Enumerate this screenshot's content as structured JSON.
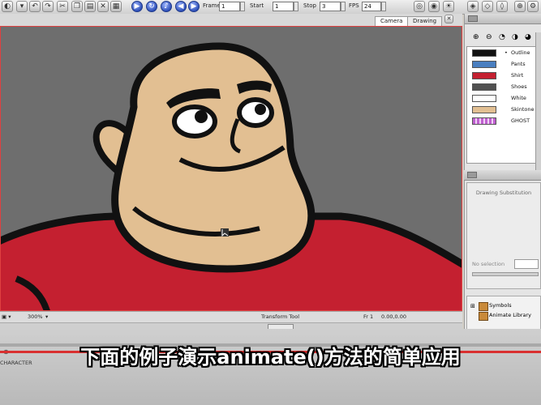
{
  "toolbar": {
    "frame_label": "Frame",
    "frame_value": "1",
    "start_label": "Start",
    "start_value": "1",
    "stop_label": "Stop",
    "stop_value": "3",
    "fps_label": "FPS",
    "fps_value": "24"
  },
  "viewport": {
    "tabs": [
      "Camera",
      "Drawing"
    ],
    "active_tab": "Camera"
  },
  "status_bar": {
    "zoom": "300%",
    "tool": "Transform Tool",
    "frame": "Fr 1",
    "coords": "0.00,0.00"
  },
  "palette": {
    "colors": [
      {
        "name": "Outline",
        "color": "#111111",
        "selected": true
      },
      {
        "name": "Pants",
        "color": "#4a7fc0",
        "selected": false
      },
      {
        "name": "Shirt",
        "color": "#c42030",
        "selected": false
      },
      {
        "name": "Shoes",
        "color": "#505050",
        "selected": false
      },
      {
        "name": "White",
        "color": "#ffffff",
        "selected": false
      },
      {
        "name": "Skintone",
        "color": "#e2bf92",
        "selected": false
      },
      {
        "name": "GHOST",
        "color": "#c060d0",
        "selected": false
      }
    ]
  },
  "drawing_panel": {
    "title": "Drawing Substitution",
    "no_selection": "No selection"
  },
  "library": {
    "items": [
      "Symbols",
      "Animate Library"
    ]
  },
  "timeline": {
    "label": "CHARACTER"
  },
  "subtitle": "下面的例子演示animate()方法的简单应用",
  "colors": {
    "canvas_bg": "#6e6e6e",
    "skin": "#e2bf92",
    "shirt": "#c42030",
    "outline": "#111111",
    "accent_red": "#d93030"
  }
}
